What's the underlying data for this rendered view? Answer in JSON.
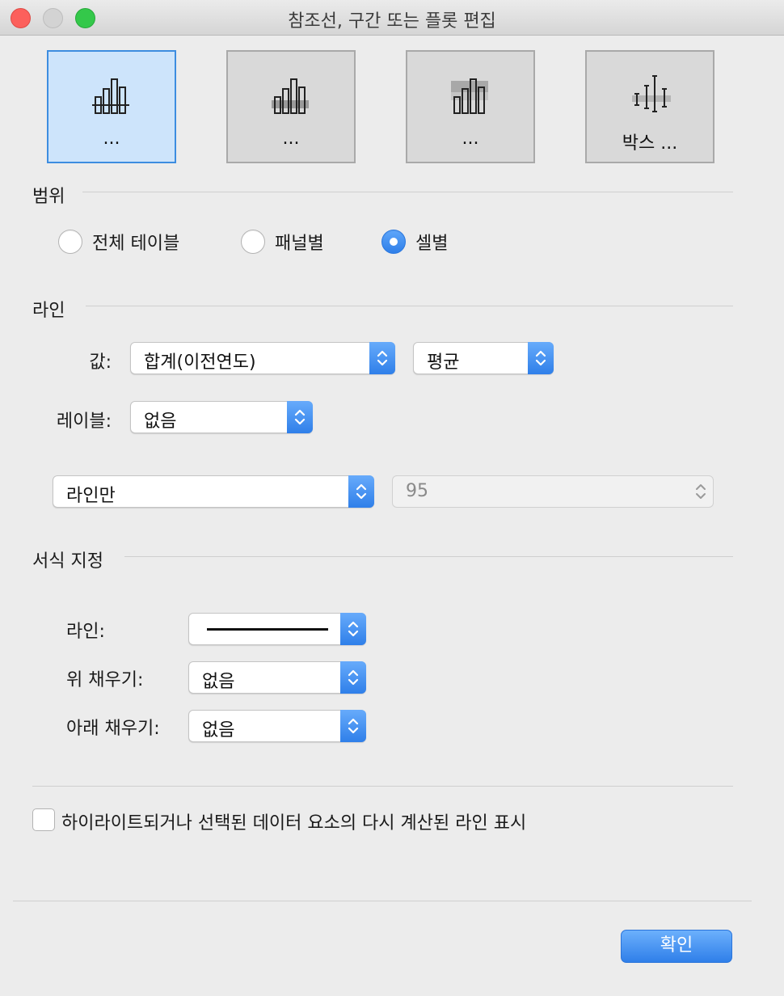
{
  "window": {
    "title": "참조선, 구간 또는 플롯 편집"
  },
  "type_tiles": [
    {
      "label": "...",
      "icon": "reference-line-icon",
      "selected": true
    },
    {
      "label": "...",
      "icon": "reference-band-icon",
      "selected": false
    },
    {
      "label": "...",
      "icon": "distribution-band-icon",
      "selected": false
    },
    {
      "label": "박스 ...",
      "icon": "box-plot-icon",
      "selected": false
    }
  ],
  "scope": {
    "title": "범위",
    "options": [
      {
        "label": "전체 테이블",
        "checked": false
      },
      {
        "label": "패널별",
        "checked": false
      },
      {
        "label": "셀별",
        "checked": true
      }
    ]
  },
  "line": {
    "title": "라인",
    "value_label": "값:",
    "value_field": "합계(이전연도)",
    "aggregation": "평균",
    "label_label": "레이블:",
    "label_value": "없음",
    "display_mode": "라인만",
    "confidence": "95"
  },
  "formatting": {
    "title": "서식 지정",
    "line_label": "라인:",
    "fill_above_label": "위 채우기:",
    "fill_above_value": "없음",
    "fill_below_label": "아래 채우기:",
    "fill_below_value": "없음"
  },
  "recalc": {
    "label": "하이라이트되거나 선택된 데이터 요소의 다시 계산된 라인 표시",
    "checked": false
  },
  "buttons": {
    "ok": "확인"
  },
  "colors": {
    "accent": "#2f7fe9",
    "selected_tile": "#cde4fb"
  }
}
